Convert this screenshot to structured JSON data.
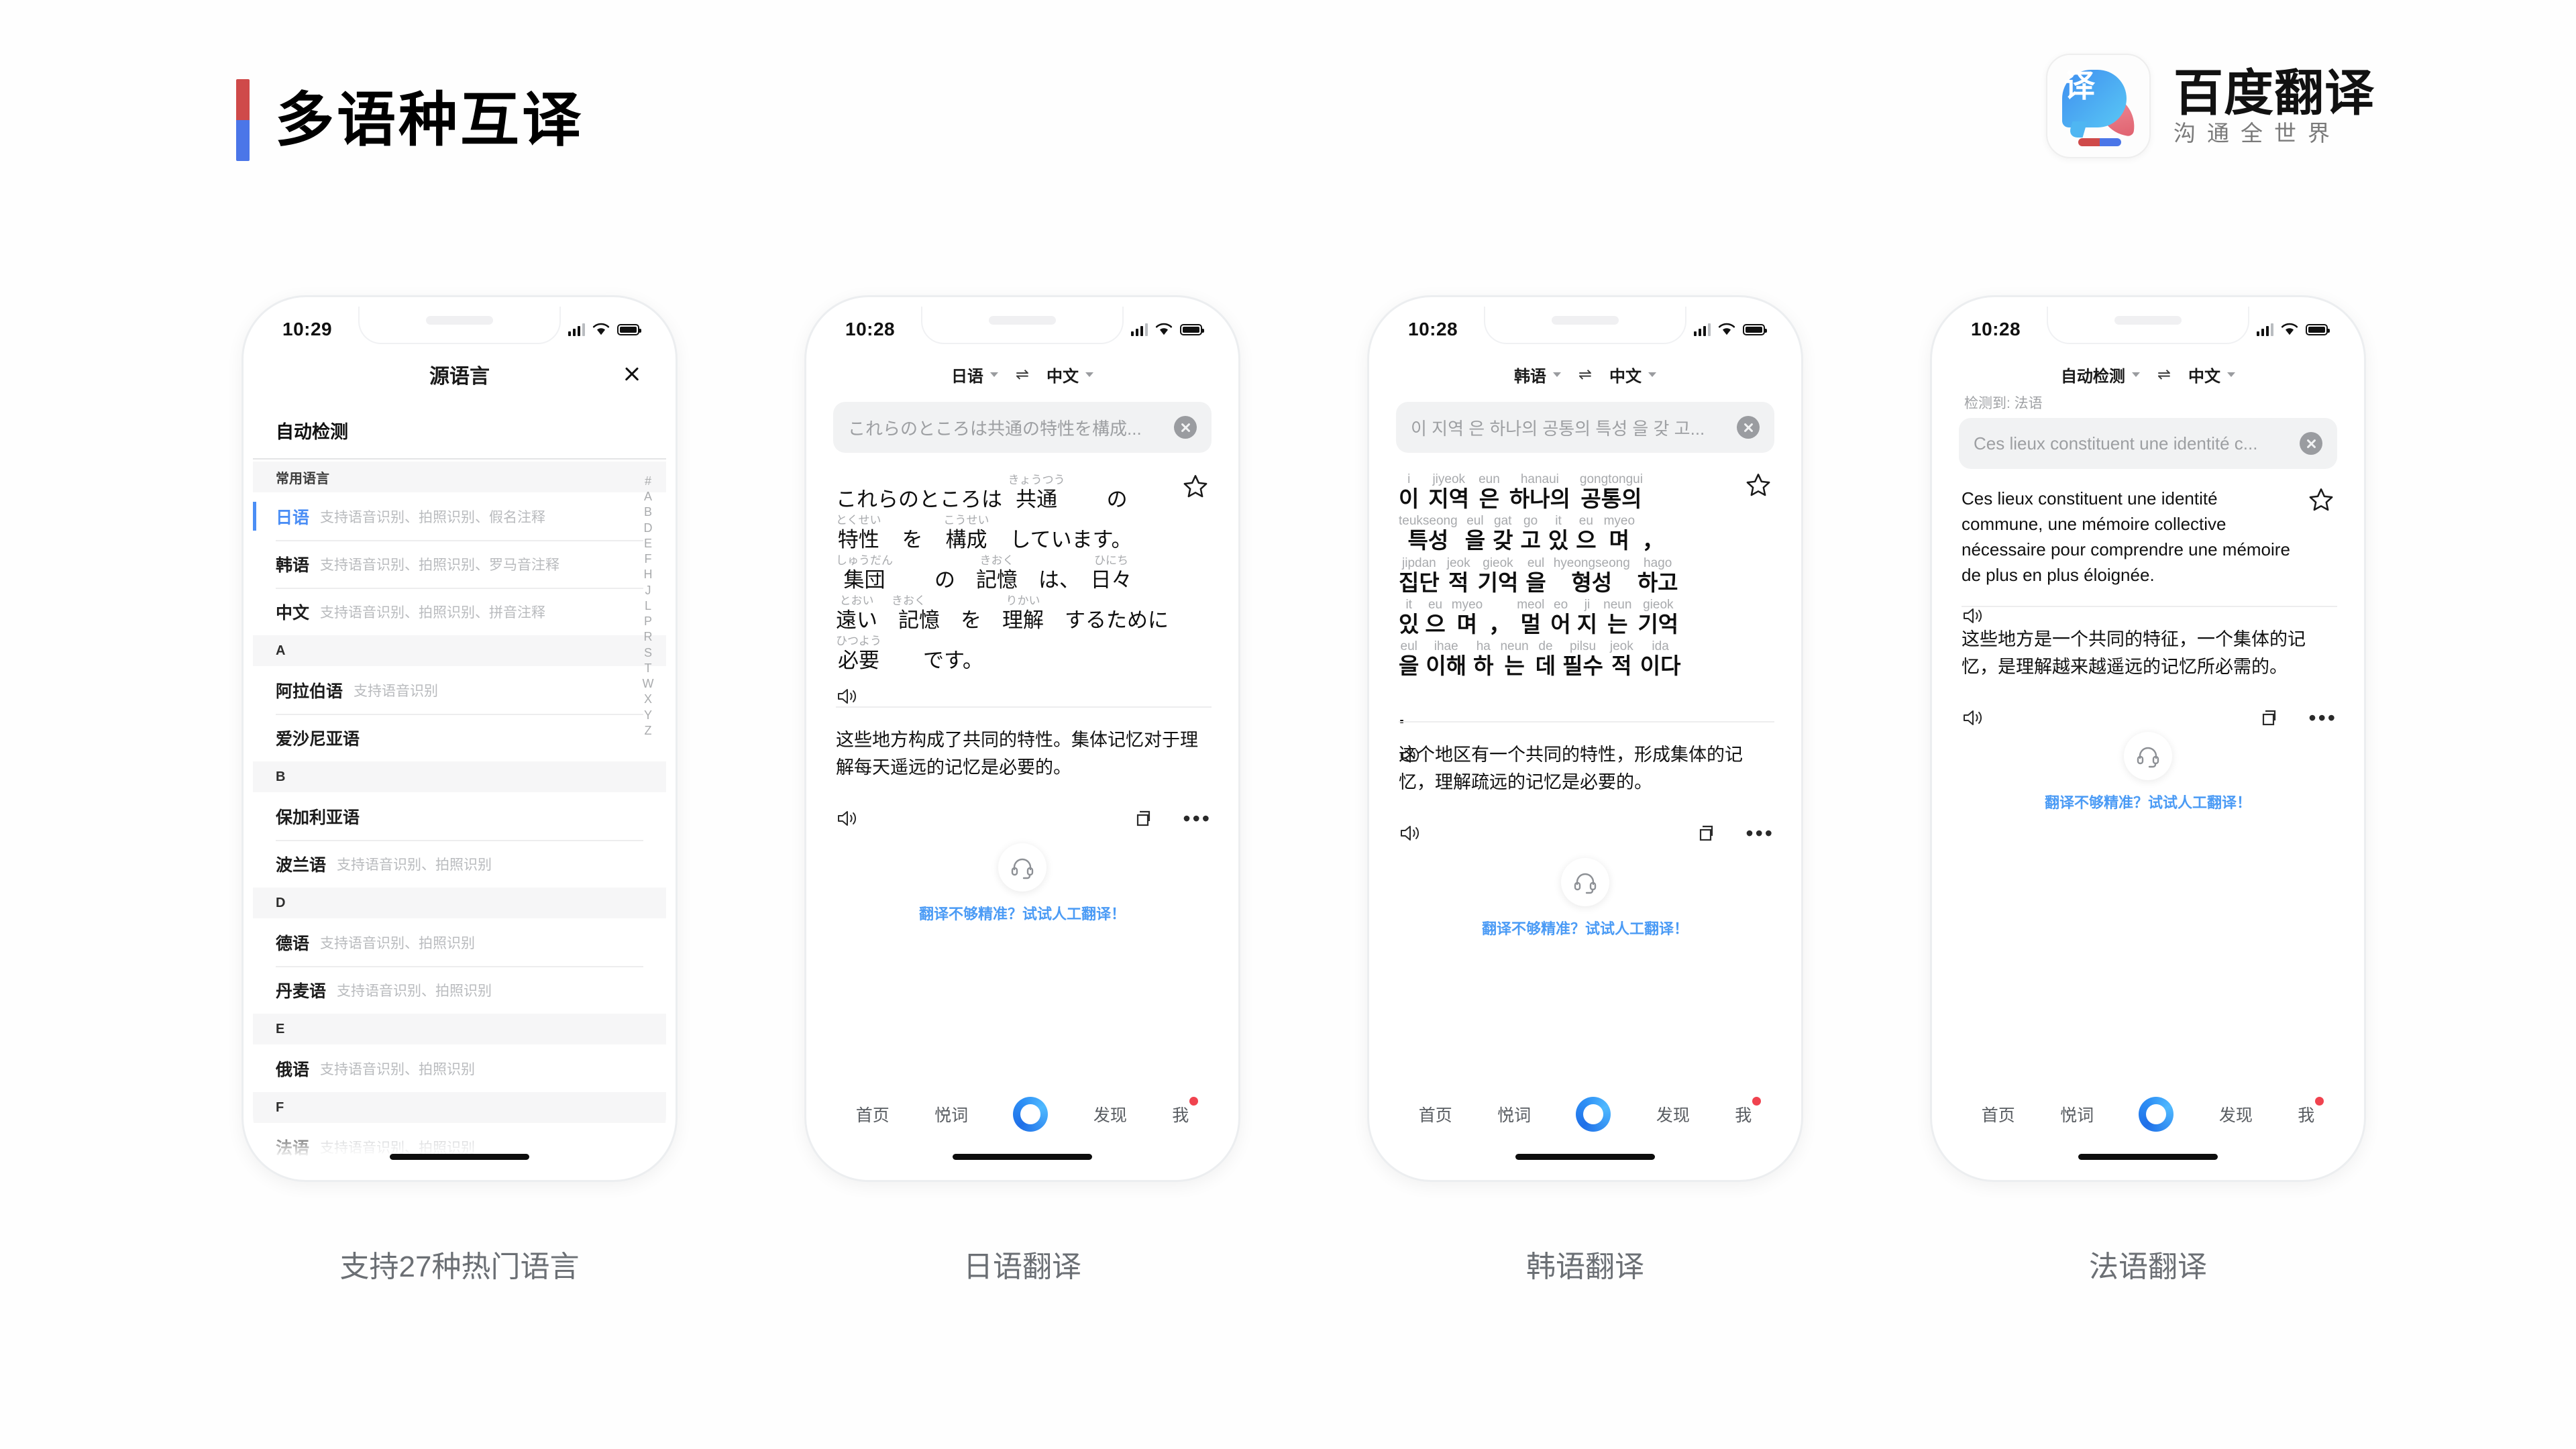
{
  "header": {
    "title": "多语种互译",
    "accent_red": "#cf4a4a",
    "accent_blue": "#4b76e8",
    "brand_name": "百度翻译",
    "brand_slogan": "沟通全世界",
    "brand_icon_char": "译"
  },
  "phones": [
    {
      "name": "language-picker",
      "status": {
        "time": "10:29"
      },
      "sheet_title": "源语言",
      "close_icon": "close-icon",
      "auto_detect": "自动检测",
      "section_common": "常用语言",
      "common_languages": [
        {
          "name": "日语",
          "desc": "支持语音识别、拍照识别、假名注释",
          "selected": true
        },
        {
          "name": "韩语",
          "desc": "支持语音识别、拍照识别、罗马音注释",
          "selected": false
        },
        {
          "name": "中文",
          "desc": "支持语音识别、拍照识别、拼音注释",
          "selected": false
        }
      ],
      "groups": [
        {
          "letter": "A",
          "items": [
            {
              "name": "阿拉伯语",
              "desc": "支持语音识别"
            },
            {
              "name": "爱沙尼亚语",
              "desc": ""
            }
          ]
        },
        {
          "letter": "B",
          "items": [
            {
              "name": "保加利亚语",
              "desc": ""
            },
            {
              "name": "波兰语",
              "desc": "支持语音识别、拍照识别"
            }
          ]
        },
        {
          "letter": "D",
          "items": [
            {
              "name": "德语",
              "desc": "支持语音识别、拍照识别"
            },
            {
              "name": "丹麦语",
              "desc": "支持语音识别、拍照识别"
            }
          ]
        },
        {
          "letter": "E",
          "items": [
            {
              "name": "俄语",
              "desc": "支持语音识别、拍照识别"
            }
          ]
        },
        {
          "letter": "F",
          "items": [
            {
              "name": "法语",
              "desc": "支持语音识别、拍照识别"
            }
          ]
        }
      ],
      "index_letters": [
        "#",
        "A",
        "B",
        "D",
        "E",
        "F",
        "H",
        "J",
        "L",
        "P",
        "R",
        "S",
        "T",
        "W",
        "X",
        "Y",
        "Z"
      ],
      "caption": "支持27种热门语言"
    },
    {
      "name": "japanese-translation",
      "status": {
        "time": "10:28"
      },
      "source_lang": "日语",
      "target_lang": "中文",
      "swap_icon": "swap-icon",
      "input_value": "これらのところは共通の特性を構成...",
      "source_ruby_lines": [
        [
          {
            "rt": "",
            "base": "これらのところは "
          },
          {
            "rt": "きょうつう",
            "base": "共通"
          },
          {
            "rt": "",
            "base": "　　の"
          }
        ],
        [
          {
            "rt": "とくせい",
            "base": "特性"
          },
          {
            "rt": "",
            "base": "　を　"
          },
          {
            "rt": "こうせい",
            "base": "構成"
          },
          {
            "rt": "",
            "base": "　しています。"
          }
        ],
        [
          {
            "rt": "しゅうだん",
            "base": "集団"
          },
          {
            "rt": "",
            "base": "　　の　"
          },
          {
            "rt": "きおく",
            "base": "記憶"
          },
          {
            "rt": "",
            "base": "　は、　"
          },
          {
            "rt": "ひにち",
            "base": "日々"
          }
        ],
        [
          {
            "rt": "とおい",
            "base": "遠い"
          },
          {
            "rt": "きおく",
            "base": "　記憶"
          },
          {
            "rt": "",
            "base": "　を　"
          },
          {
            "rt": "りかい",
            "base": "理解"
          },
          {
            "rt": "",
            "base": "　するために"
          }
        ],
        [
          {
            "rt": "ひつよう",
            "base": "必要"
          },
          {
            "rt": "",
            "base": "　　です。"
          }
        ]
      ],
      "target_text": "这些地方构成了共同的特性。集体记忆对于理解每天遥远的记忆是必要的。",
      "star_icon": "star-icon",
      "speaker_icon": "speaker-icon",
      "copy_icon": "copy-icon",
      "more_icon": "more-icon",
      "human_icon": "headset-icon",
      "human_link": "翻译不够精准？试试人工翻译！",
      "tabs": [
        {
          "label": "首页",
          "badge": false
        },
        {
          "label": "悦词",
          "badge": false
        },
        {
          "label": "",
          "badge": false,
          "center": true
        },
        {
          "label": "发现",
          "badge": false
        },
        {
          "label": "我",
          "badge": true
        }
      ],
      "caption": "日语翻译"
    },
    {
      "name": "korean-translation",
      "status": {
        "time": "10:28"
      },
      "source_lang": "韩语",
      "target_lang": "中文",
      "swap_icon": "swap-icon",
      "input_value": "이 지역 은 하나의 공통의 특성 을 갖 고...",
      "source_ruby_lines": [
        [
          {
            "rt": "i",
            "base": "이"
          },
          {
            "rt": "jiyeok",
            "base": "지역"
          },
          {
            "rt": "eun",
            "base": "은"
          },
          {
            "rt": "hanaui",
            "base": "하나의"
          },
          {
            "rt": "gongtongui",
            "base": "공통의"
          }
        ],
        [
          {
            "rt": "teukseong",
            "base": "특성"
          },
          {
            "rt": "eul",
            "base": "을"
          },
          {
            "rt": "gat",
            "base": "갖"
          },
          {
            "rt": "go",
            "base": "고"
          },
          {
            "rt": "it",
            "base": "있"
          },
          {
            "rt": "eu",
            "base": "으"
          },
          {
            "rt": "myeo",
            "base": "며"
          },
          {
            "rt": "",
            "base": "，"
          }
        ],
        [
          {
            "rt": "jipdan",
            "base": "집단"
          },
          {
            "rt": "jeok",
            "base": "적"
          },
          {
            "rt": "gieok",
            "base": "기억"
          },
          {
            "rt": "eul",
            "base": "을"
          },
          {
            "rt": "hyeongseong",
            "base": "형성"
          },
          {
            "rt": "hago",
            "base": "하고"
          }
        ],
        [
          {
            "rt": "it",
            "base": "있"
          },
          {
            "rt": "eu",
            "base": "으"
          },
          {
            "rt": "myeo",
            "base": "며"
          },
          {
            "rt": "",
            "base": "，"
          },
          {
            "rt": "meol",
            "base": "멀"
          },
          {
            "rt": "eo",
            "base": "어"
          },
          {
            "rt": "ji",
            "base": "지"
          },
          {
            "rt": "neun",
            "base": "는"
          },
          {
            "rt": "gieok",
            "base": "기억"
          }
        ],
        [
          {
            "rt": "eul",
            "base": "을"
          },
          {
            "rt": "ihae",
            "base": "이해"
          },
          {
            "rt": "ha",
            "base": "하"
          },
          {
            "rt": "neun",
            "base": "는"
          },
          {
            "rt": "de",
            "base": "데"
          },
          {
            "rt": "pilsu",
            "base": "필수"
          },
          {
            "rt": "jeok",
            "base": "적"
          },
          {
            "rt": "ida",
            "base": "이다"
          }
        ],
        [
          {
            "rt": "",
            "base": "."
          }
        ]
      ],
      "target_text": "这个地区有一个共同的特性，形成集体的记忆，理解疏远的记忆是必要的。",
      "star_icon": "star-icon",
      "speaker_icon": "speaker-icon",
      "copy_icon": "copy-icon",
      "more_icon": "more-icon",
      "human_icon": "headset-icon",
      "human_link": "翻译不够精准？试试人工翻译！",
      "tabs": [
        {
          "label": "首页",
          "badge": false
        },
        {
          "label": "悦词",
          "badge": false
        },
        {
          "label": "",
          "badge": false,
          "center": true
        },
        {
          "label": "发现",
          "badge": false
        },
        {
          "label": "我",
          "badge": true
        }
      ],
      "caption": "韩语翻译"
    },
    {
      "name": "french-translation",
      "status": {
        "time": "10:28"
      },
      "source_lang": "自动检测",
      "target_lang": "中文",
      "swap_icon": "swap-icon",
      "detected_note": "检测到: 法语",
      "input_value": "Ces lieux constituent une identité c...",
      "source_text": "Ces lieux constituent une identité commune, une mémoire collective nécessaire pour comprendre une mémoire de plus en plus éloignée.",
      "target_text": "这些地方是一个共同的特征，一个集体的记忆，是理解越来越遥远的记忆所必需的。",
      "star_icon": "star-icon",
      "speaker_icon": "speaker-icon",
      "copy_icon": "copy-icon",
      "more_icon": "more-icon",
      "human_icon": "headset-icon",
      "human_link": "翻译不够精准？试试人工翻译！",
      "tabs": [
        {
          "label": "首页",
          "badge": false
        },
        {
          "label": "悦词",
          "badge": false
        },
        {
          "label": "",
          "badge": false,
          "center": true
        },
        {
          "label": "发现",
          "badge": false
        },
        {
          "label": "我",
          "badge": true
        }
      ],
      "caption": "法语翻译"
    }
  ]
}
